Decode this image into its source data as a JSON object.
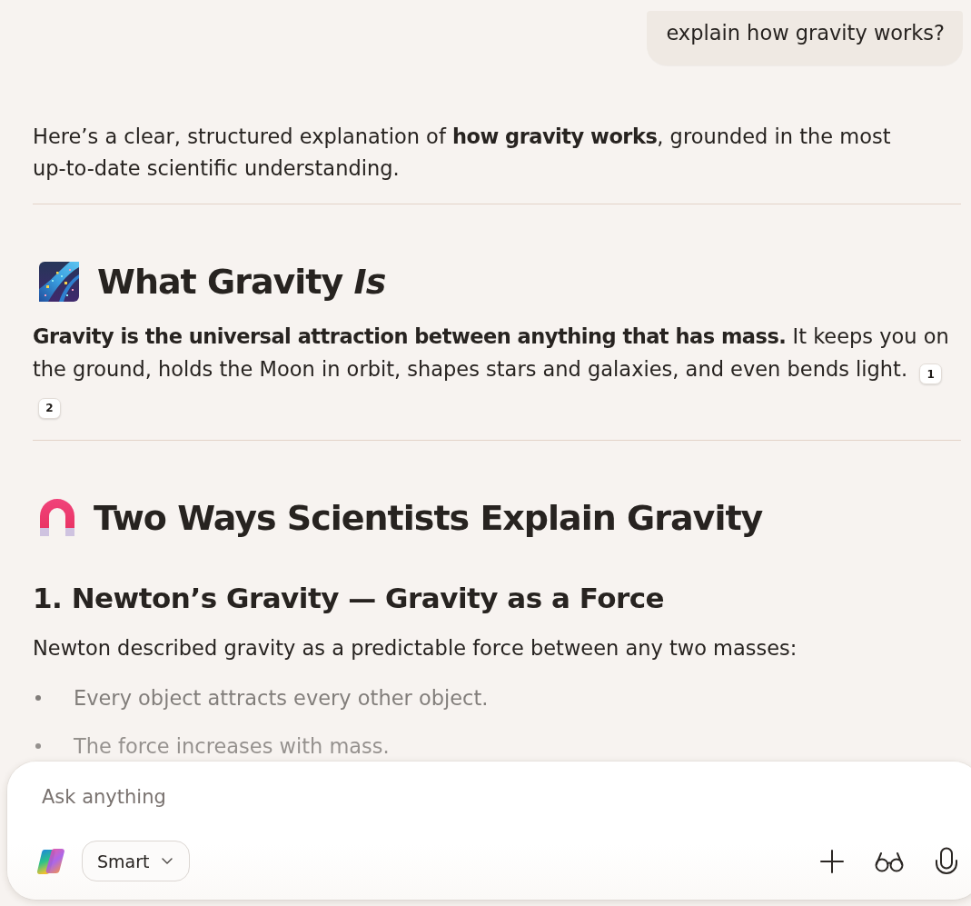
{
  "user_message": {
    "text": "explain how gravity works?"
  },
  "response": {
    "blocks": [
      {
        "kind": "paragraph",
        "text": "Here’s a clear, structured explanation of **how gravity works**, grounded in the most up-to-date scientific understanding."
      },
      {
        "kind": "divider"
      },
      {
        "kind": "heading",
        "text": "What Gravity *Is*"
      },
      {
        "kind": "paragraph",
        "text": "**Gravity is the universal attraction between anything that has mass.** It keeps you on the ground, holds the Moon in orbit, shapes stars and galaxies, and even bends light.",
        "citations": [
          "1",
          "2"
        ]
      },
      {
        "kind": "divider"
      },
      {
        "kind": "heading",
        "text": "Two Ways Scientists Explain Gravity"
      },
      {
        "kind": "subheading",
        "text": "1. Newton’s Gravity — Gravity as a Force"
      },
      {
        "kind": "paragraph",
        "text": "Newton described gravity as a predictable force between any two masses:"
      },
      {
        "kind": "list",
        "items": [
          "Every object attracts every other object.",
          "The force increases with mass."
        ]
      }
    ]
  },
  "composer": {
    "placeholder": "Ask anything",
    "mode": "Smart"
  }
}
